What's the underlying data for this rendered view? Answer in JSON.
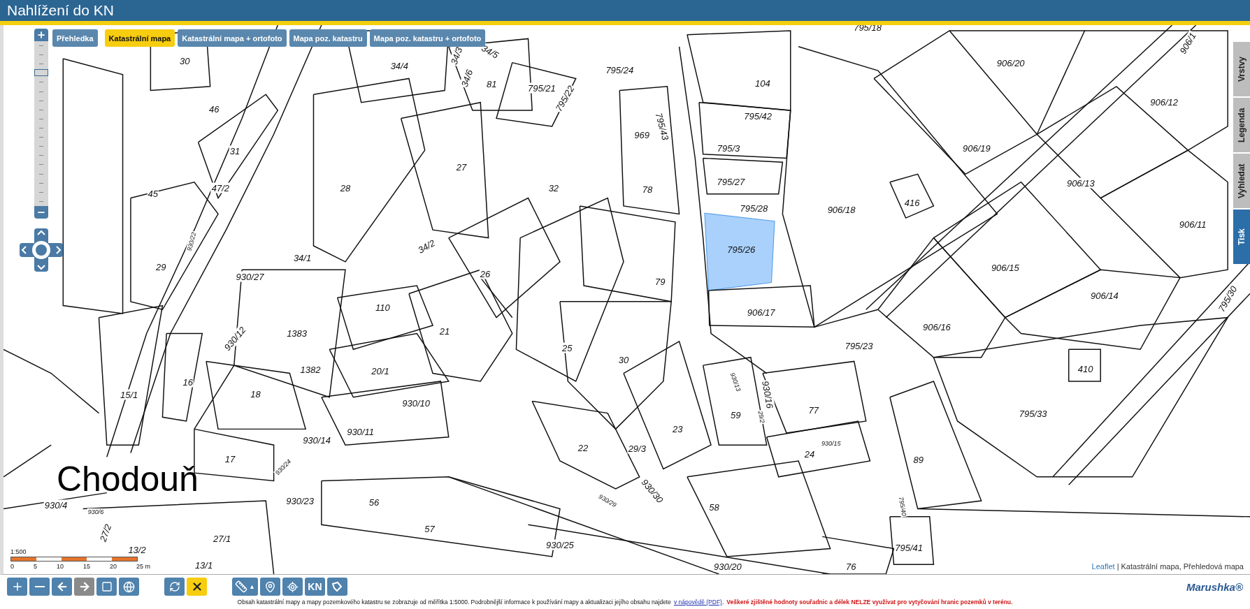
{
  "header": {
    "title": "Nahlížení do KN"
  },
  "map_tabs": [
    {
      "label": "Přehledka",
      "selected": false
    },
    {
      "label": "Katastrální mapa",
      "selected": true
    },
    {
      "label": "Katastrální mapa + ortofoto",
      "selected": false
    },
    {
      "label": "Mapa poz. katastru",
      "selected": false
    },
    {
      "label": "Mapa poz. katastru + ortofoto",
      "selected": false
    }
  ],
  "side_tabs": [
    {
      "label": "Vrstvy",
      "selected": false
    },
    {
      "label": "Legenda",
      "selected": false
    },
    {
      "label": "Vyhledat",
      "selected": false
    },
    {
      "label": "Tisk",
      "selected": true
    }
  ],
  "zoom": {
    "level": 0.81
  },
  "map": {
    "place_name": "Chodouň",
    "parcels": [
      {
        "label": "30",
        "selected": false
      },
      {
        "label": "46",
        "selected": false
      },
      {
        "label": "31",
        "selected": false
      },
      {
        "label": "47/2",
        "selected": false
      },
      {
        "label": "45",
        "selected": false
      },
      {
        "label": "28",
        "selected": false
      },
      {
        "label": "27",
        "selected": false
      },
      {
        "label": "81",
        "selected": false
      },
      {
        "label": "34/4",
        "selected": false
      },
      {
        "label": "34/3",
        "selected": false
      },
      {
        "label": "34/5",
        "selected": false
      },
      {
        "label": "34/6",
        "selected": false
      },
      {
        "label": "795/21",
        "selected": false
      },
      {
        "label": "795/22",
        "selected": false
      },
      {
        "label": "795/24",
        "selected": false
      },
      {
        "label": "795/18",
        "selected": false
      },
      {
        "label": "104",
        "selected": false
      },
      {
        "label": "795/42",
        "selected": false
      },
      {
        "label": "795/3",
        "selected": false
      },
      {
        "label": "795/27",
        "selected": false
      },
      {
        "label": "795/28",
        "selected": false
      },
      {
        "label": "795/26",
        "selected": true
      },
      {
        "label": "906/17",
        "selected": false
      },
      {
        "label": "969",
        "selected": false
      },
      {
        "label": "795/43",
        "selected": false
      },
      {
        "label": "78",
        "selected": false
      },
      {
        "label": "79",
        "selected": false
      },
      {
        "label": "32",
        "selected": false
      },
      {
        "label": "34/1",
        "selected": false
      },
      {
        "label": "34/2",
        "selected": false
      },
      {
        "label": "29",
        "selected": false
      },
      {
        "label": "930/22",
        "selected": false
      },
      {
        "label": "930/27",
        "selected": false
      },
      {
        "label": "26",
        "selected": false
      },
      {
        "label": "110",
        "selected": false
      },
      {
        "label": "1383",
        "selected": false
      },
      {
        "label": "21",
        "selected": false
      },
      {
        "label": "930/12",
        "selected": false
      },
      {
        "label": "1382",
        "selected": false
      },
      {
        "label": "20/1",
        "selected": false
      },
      {
        "label": "930/10",
        "selected": false
      },
      {
        "label": "25",
        "selected": false
      },
      {
        "label": "30",
        "selected": false
      },
      {
        "label": "18",
        "selected": false
      },
      {
        "label": "16",
        "selected": false
      },
      {
        "label": "15/1",
        "selected": false
      },
      {
        "label": "930/11",
        "selected": false
      },
      {
        "label": "930/14",
        "selected": false
      },
      {
        "label": "17",
        "selected": false
      },
      {
        "label": "930/24",
        "selected": false
      },
      {
        "label": "22",
        "selected": false
      },
      {
        "label": "29/3",
        "selected": false
      },
      {
        "label": "23",
        "selected": false
      },
      {
        "label": "930/29",
        "selected": false
      },
      {
        "label": "930/30",
        "selected": false
      },
      {
        "label": "59",
        "selected": false
      },
      {
        "label": "930/13",
        "selected": false
      },
      {
        "label": "930/16",
        "selected": false
      },
      {
        "label": "29/2",
        "selected": false
      },
      {
        "label": "77",
        "selected": false
      },
      {
        "label": "24",
        "selected": false
      },
      {
        "label": "930/15",
        "selected": false
      },
      {
        "label": "89",
        "selected": false
      },
      {
        "label": "795/33",
        "selected": false
      },
      {
        "label": "410",
        "selected": false
      },
      {
        "label": "906/18",
        "selected": false
      },
      {
        "label": "416",
        "selected": false
      },
      {
        "label": "906/20",
        "selected": false
      },
      {
        "label": "906/19",
        "selected": false
      },
      {
        "label": "906/13",
        "selected": false
      },
      {
        "label": "906/12",
        "selected": false
      },
      {
        "label": "906/11",
        "selected": false
      },
      {
        "label": "906/15",
        "selected": false
      },
      {
        "label": "906/14",
        "selected": false
      },
      {
        "label": "906/16",
        "selected": false
      },
      {
        "label": "795/23",
        "selected": false
      },
      {
        "label": "795/30",
        "selected": false
      },
      {
        "label": "906/1",
        "selected": false
      },
      {
        "label": "930/4",
        "selected": false
      },
      {
        "label": "930/23",
        "selected": false
      },
      {
        "label": "56",
        "selected": false
      },
      {
        "label": "57",
        "selected": false
      },
      {
        "label": "930/25",
        "selected": false
      },
      {
        "label": "58",
        "selected": false
      },
      {
        "label": "930/20",
        "selected": false
      },
      {
        "label": "76",
        "selected": false
      },
      {
        "label": "795/41",
        "selected": false
      },
      {
        "label": "795/40",
        "selected": false
      },
      {
        "label": "930/6",
        "selected": false
      },
      {
        "label": "27/2",
        "selected": false
      },
      {
        "label": "13/2",
        "selected": false
      },
      {
        "label": "27/1",
        "selected": false
      },
      {
        "label": "13/1",
        "selected": false
      }
    ]
  },
  "scale": {
    "ratio": "1:500",
    "ticks": [
      "0",
      "5",
      "10",
      "15",
      "20",
      "25 m"
    ]
  },
  "attribution": {
    "link": "Leaflet",
    "separator": "|",
    "layers": "Katastrální mapa, Přehledová mapa"
  },
  "toolbar": {
    "nav": [
      {
        "disabled": false
      },
      {
        "disabled": false
      },
      {
        "disabled": false
      },
      {
        "disabled": true
      },
      {
        "disabled": false
      },
      {
        "disabled": false
      }
    ],
    "actions": [
      {
        "selected": false
      },
      {
        "selected": true
      }
    ],
    "measure_caret": "▲",
    "tools_text": "KN"
  },
  "logo": "Marushka®",
  "footer": {
    "note": "Obsah katastrální mapy a mapy pozemkového katastru se zobrazuje od měřítka 1:5000. Podrobnější informace k používání mapy a aktualizaci jejího obsahu najdete",
    "link": "v nápovědě (PDF)",
    "link_after": ".",
    "warning": "Veškeré zjištěné hodnoty souřadnic a délek NELZE využívat pro vytyčování hranic pozemků v terénu."
  }
}
